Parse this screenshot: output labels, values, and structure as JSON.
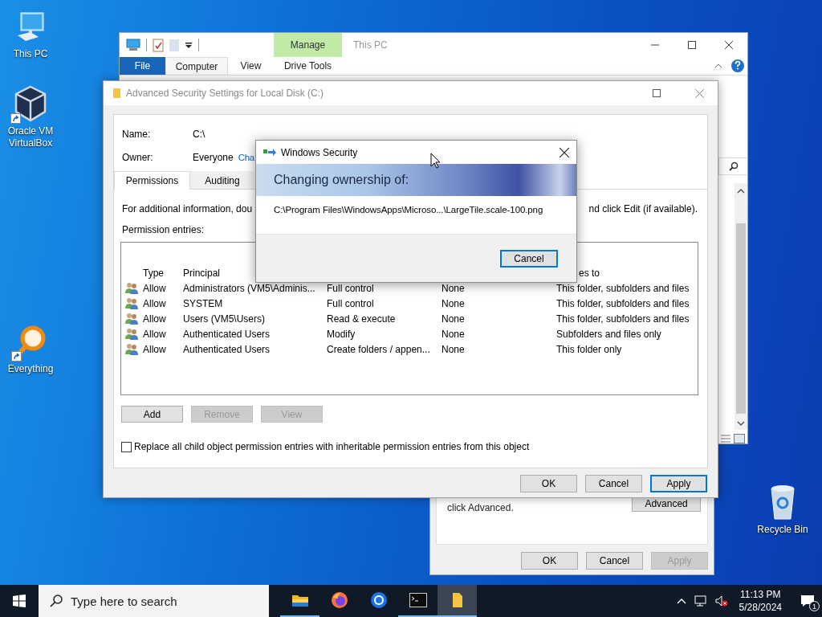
{
  "desktop_icons": [
    {
      "kind": "computer",
      "label": "This PC",
      "shortcut": false
    },
    {
      "kind": "virtualbox",
      "label": "Oracle VM VirtualBox",
      "shortcut": true
    },
    {
      "kind": "everything",
      "label": "Everything",
      "shortcut": true
    },
    {
      "kind": "recycle",
      "label": "Recycle Bin",
      "shortcut": false
    }
  ],
  "explorer": {
    "contextual_tab": "Manage",
    "title": "This PC",
    "tabs": [
      {
        "label": "File",
        "kind": "file",
        "selected": false
      },
      {
        "label": "Computer",
        "kind": "ribbon",
        "selected": true
      },
      {
        "label": "View",
        "kind": "ribbon",
        "selected": false
      },
      {
        "label": "Drive Tools",
        "kind": "ribbon",
        "selected": false
      }
    ]
  },
  "properties": {
    "text": "click Advanced.",
    "advanced_button": "Advanced",
    "buttons": [
      {
        "label": "OK",
        "disabled": false
      },
      {
        "label": "Cancel",
        "disabled": false
      },
      {
        "label": "Apply",
        "disabled": true
      }
    ]
  },
  "advanced": {
    "title": "Advanced Security Settings for Local Disk (C:)",
    "name_label": "Name:",
    "name_value": "C:\\",
    "owner_label": "Owner:",
    "owner_value": "Everyone",
    "change_link": "Cha",
    "tabs": [
      {
        "label": "Permissions",
        "selected": true
      },
      {
        "label": "Auditing",
        "selected": false
      }
    ],
    "info_text": [
      "For additional information, dou",
      "nd click Edit (if available)."
    ],
    "entries_label": "Permission entries:",
    "columns": [
      {
        "kind": "type",
        "label": "Type"
      },
      {
        "kind": "principal",
        "label": "Principal"
      },
      {
        "kind": "applies",
        "label": "es to"
      }
    ],
    "rows": [
      {
        "type": "Allow",
        "principal": "Administrators (VM5\\Adminis...",
        "access": "Full control",
        "inherited": "None",
        "applies": "This folder, subfolders and files"
      },
      {
        "type": "Allow",
        "principal": "SYSTEM",
        "access": "Full control",
        "inherited": "None",
        "applies": "This folder, subfolders and files"
      },
      {
        "type": "Allow",
        "principal": "Users (VM5\\Users)",
        "access": "Read & execute",
        "inherited": "None",
        "applies": "This folder, subfolders and files"
      },
      {
        "type": "Allow",
        "principal": "Authenticated Users",
        "access": "Modify",
        "inherited": "None",
        "applies": "Subfolders and files only"
      },
      {
        "type": "Allow",
        "principal": "Authenticated Users",
        "access": "Create folders / appen...",
        "inherited": "None",
        "applies": "This folder only"
      }
    ],
    "entry_buttons": [
      {
        "label": "Add",
        "disabled": false
      },
      {
        "label": "Remove",
        "disabled": true
      },
      {
        "label": "View",
        "disabled": true
      }
    ],
    "replace_checkbox": {
      "label": "Replace all child object permission entries with inheritable permission entries from this object",
      "checked": false
    },
    "buttons": [
      {
        "label": "OK",
        "default": false
      },
      {
        "label": "Cancel",
        "default": false
      },
      {
        "label": "Apply",
        "default": true
      }
    ]
  },
  "security": {
    "title": "Windows Security",
    "heading": "Changing ownership of:",
    "path": "C:\\Program Files\\WindowsApps\\Microso...\\LargeTile.scale-100.png",
    "button": {
      "label": "Cancel",
      "default": true
    }
  },
  "taskbar": {
    "search_placeholder": "Type here to search",
    "apps": [
      {
        "kind": "explorer",
        "running": true,
        "active": false
      },
      {
        "kind": "firefox",
        "running": false,
        "active": false
      },
      {
        "kind": "chrome",
        "running": false,
        "active": false
      },
      {
        "kind": "terminal",
        "running": true,
        "active": false
      },
      {
        "kind": "folder",
        "running": true,
        "active": true
      }
    ],
    "time": "11:13 PM",
    "date": "5/28/2024",
    "notification_count": "1"
  }
}
